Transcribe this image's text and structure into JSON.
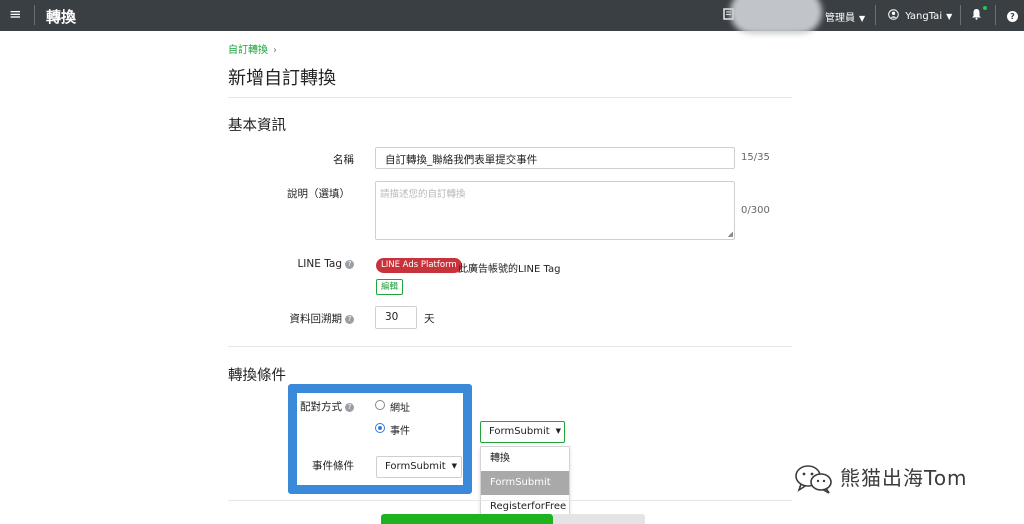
{
  "topbar": {
    "menu_icon": "hamburger-icon",
    "title": "轉換",
    "account_icon": "document-icon",
    "role_label": "管理員",
    "user_name": "YangTai",
    "user_icon": "user-circle-icon",
    "bell_icon": "bell-icon",
    "help_icon": "question-icon",
    "help_glyph": "?"
  },
  "breadcrumb": {
    "link": "自訂轉換",
    "separator": "›"
  },
  "page": {
    "title": "新增自訂轉換"
  },
  "basic_info": {
    "section_title": "基本資訊",
    "name_label": "名稱",
    "name_value": "自訂轉換_聯絡我們表單提交事件",
    "name_counter": "15/35",
    "description_label": "說明（選填）",
    "description_placeholder": "請描述您的自訂轉換",
    "description_counter": "0/300",
    "line_tag_label": "LINE Tag",
    "line_tag_badge": "LINE Ads Platform",
    "line_tag_text": "此廣告帳號的LINE Tag",
    "edit_button": "編輯",
    "lookback_label": "資料回溯期",
    "lookback_value": "30",
    "lookback_unit": "天"
  },
  "conditions": {
    "section_title": "轉換條件",
    "match_label": "配對方式",
    "option_url": "網址",
    "option_event": "事件",
    "selected_option": "事件",
    "event_condition_label": "事件條件",
    "event_select_value": "FormSubmit",
    "open_select_value": "FormSubmit",
    "dropdown_options": [
      "轉換",
      "FormSubmit",
      "RegisterforFree"
    ],
    "highlighted_option": "FormSubmit"
  },
  "watermark": {
    "text": "熊猫出海Tom",
    "icon": "wechat-logo-icon"
  },
  "colors": {
    "accent_green": "#1fa33a",
    "badge_red": "#c8323b",
    "highlight_blue": "#3b8ad9",
    "topbar": "#3a3f44"
  }
}
